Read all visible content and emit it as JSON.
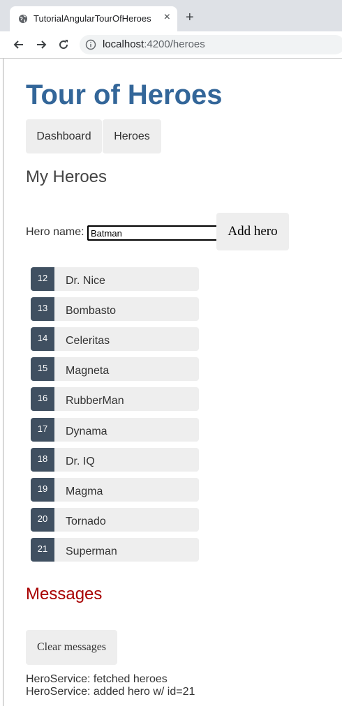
{
  "browser": {
    "tab_title": "TutorialAngularTourOfHeroes",
    "close_glyph": "×",
    "new_tab_glyph": "+",
    "url_host": "localhost",
    "url_rest": ":4200/heroes"
  },
  "app": {
    "title": "Tour of Heroes",
    "nav": [
      {
        "label": "Dashboard"
      },
      {
        "label": "Heroes"
      }
    ],
    "section_title": "My Heroes",
    "hero_name_label": "Hero name:",
    "hero_name_value": "Batman",
    "add_button": "Add hero",
    "heroes": [
      {
        "id": "12",
        "name": "Dr. Nice"
      },
      {
        "id": "13",
        "name": "Bombasto"
      },
      {
        "id": "14",
        "name": "Celeritas"
      },
      {
        "id": "15",
        "name": "Magneta"
      },
      {
        "id": "16",
        "name": "RubberMan"
      },
      {
        "id": "17",
        "name": "Dynama"
      },
      {
        "id": "18",
        "name": "Dr. IQ"
      },
      {
        "id": "19",
        "name": "Magma"
      },
      {
        "id": "20",
        "name": "Tornado"
      },
      {
        "id": "21",
        "name": "Superman"
      }
    ],
    "messages_title": "Messages",
    "clear_button": "Clear messages",
    "messages": [
      "HeroService: fetched heroes",
      "HeroService: added hero w/ id=21"
    ]
  },
  "colors": {
    "title": "#336699",
    "badge": "#405061",
    "messages_title": "#a80000",
    "button_bg": "#eeeeee"
  }
}
